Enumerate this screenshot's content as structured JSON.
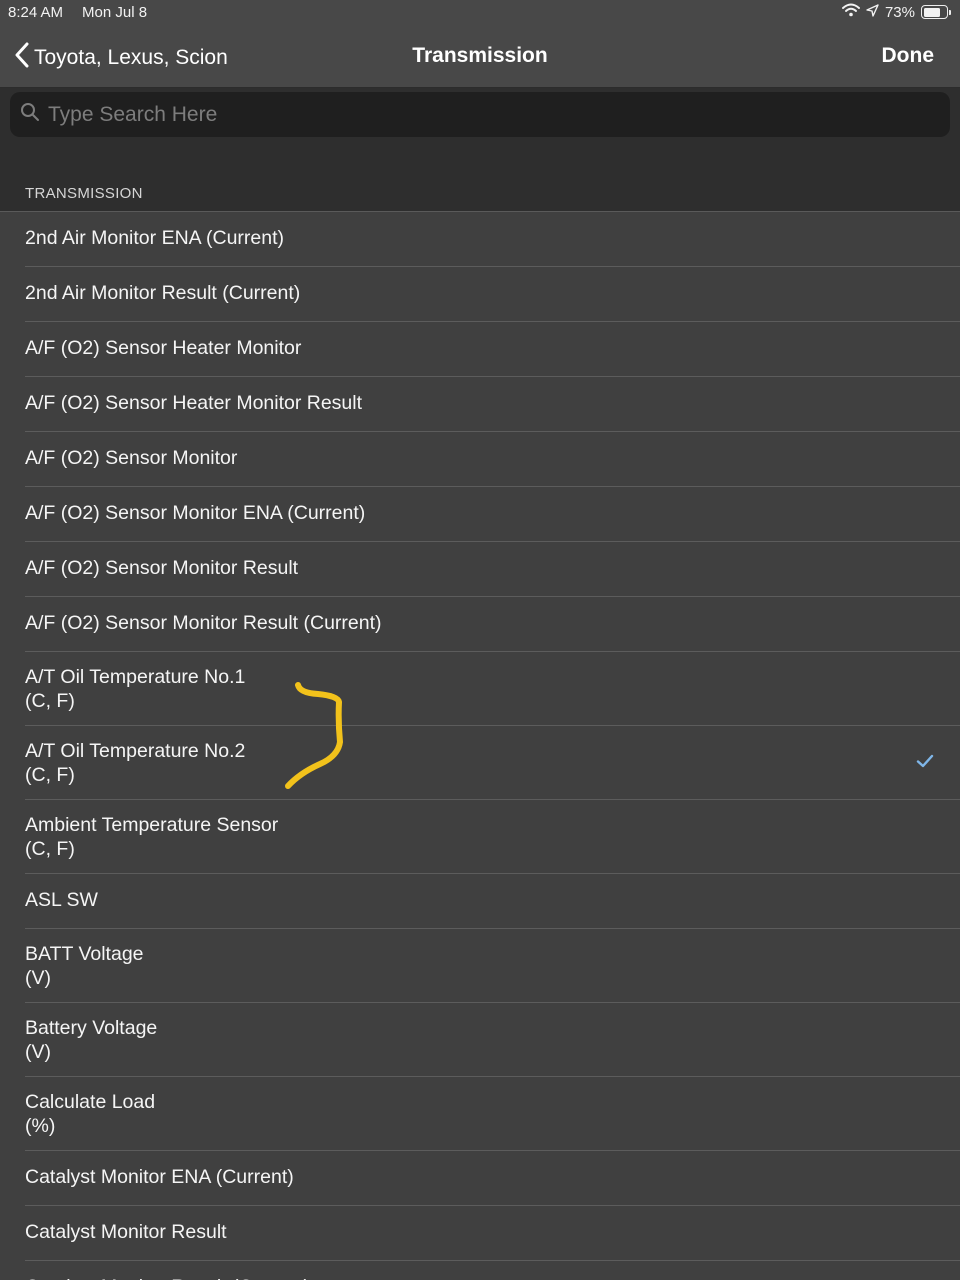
{
  "status_bar": {
    "time": "8:24 AM",
    "date": "Mon Jul 8",
    "battery": "73%",
    "battery_level": 0.73,
    "icons": [
      "wifi-icon",
      "location-arrow-icon",
      "battery-icon"
    ]
  },
  "nav": {
    "back_label": "Toyota, Lexus, Scion",
    "title": "Transmission",
    "done_label": "Done"
  },
  "search": {
    "placeholder": "Type Search Here",
    "value": ""
  },
  "section": {
    "header": "TRANSMISSION"
  },
  "items": [
    {
      "name": "2nd Air Monitor ENA (Current)",
      "unit": "",
      "checked": false
    },
    {
      "name": "2nd Air Monitor Result (Current)",
      "unit": "",
      "checked": false
    },
    {
      "name": "A/F (O2) Sensor Heater Monitor",
      "unit": "",
      "checked": false
    },
    {
      "name": "A/F (O2) Sensor Heater Monitor Result",
      "unit": "",
      "checked": false
    },
    {
      "name": "A/F (O2) Sensor Monitor",
      "unit": "",
      "checked": false
    },
    {
      "name": "A/F (O2) Sensor Monitor ENA (Current)",
      "unit": "",
      "checked": false
    },
    {
      "name": "A/F (O2) Sensor Monitor Result",
      "unit": "",
      "checked": false
    },
    {
      "name": "A/F (O2) Sensor Monitor Result (Current)",
      "unit": "",
      "checked": false
    },
    {
      "name": "A/T Oil Temperature No.1",
      "unit": "(C, F)",
      "checked": false
    },
    {
      "name": "A/T Oil Temperature No.2",
      "unit": "(C, F)",
      "checked": true
    },
    {
      "name": "Ambient Temperature Sensor",
      "unit": "(C, F)",
      "checked": false
    },
    {
      "name": "ASL SW",
      "unit": "",
      "checked": false
    },
    {
      "name": "BATT Voltage",
      "unit": "(V)",
      "checked": false
    },
    {
      "name": "Battery Voltage",
      "unit": "(V)",
      "checked": false
    },
    {
      "name": "Calculate Load",
      "unit": "(%)",
      "checked": false
    },
    {
      "name": "Catalyst Monitor ENA (Current)",
      "unit": "",
      "checked": false
    },
    {
      "name": "Catalyst Monitor Result",
      "unit": "",
      "checked": false
    },
    {
      "name": "Catalyst Monitor Result (Current)",
      "unit": "",
      "checked": false
    }
  ],
  "colors": {
    "accent_check": "#7fb6e8",
    "annotation": "#f2c21b"
  }
}
